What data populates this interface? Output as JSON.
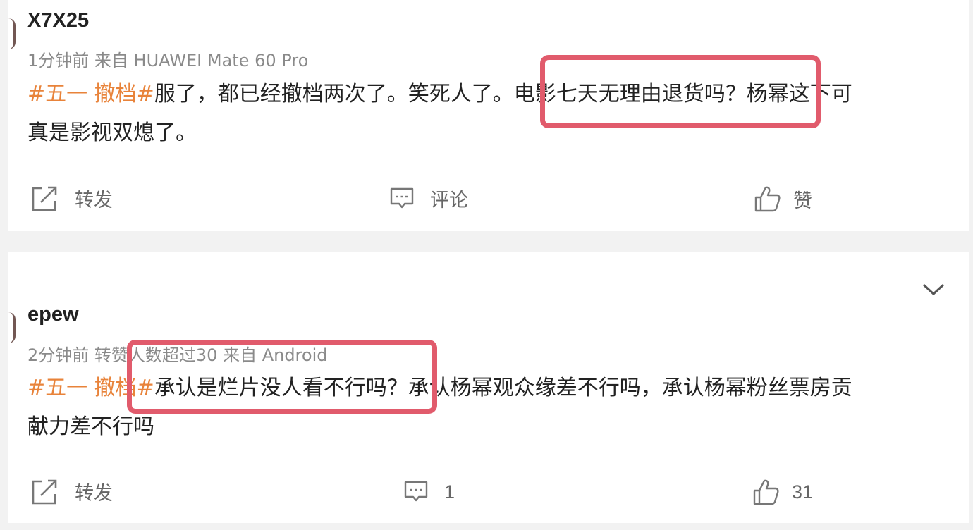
{
  "posts": [
    {
      "username": "X7X25",
      "meta": "1分钟前  来自 HUAWEI Mate 60 Pro",
      "topic": "#五一 撤档#",
      "text_line1": "服了，都已经撤档两次了。笑死人了。电影七天无理由退货吗？杨幂这下可",
      "text_line2": "真是影视双熄了。",
      "actions": {
        "repost_label": "转发",
        "comment_label": "评论",
        "like_label": "赞"
      }
    },
    {
      "username": "epew",
      "meta": "2分钟前  转赞人数超过30  来自 Android",
      "topic": "#五一 撤档#",
      "text_line1": "承认是烂片没人看不行吗？承认杨幂观众缘差不行吗，承认杨幂粉丝票房贡",
      "text_line2": "献力差不行吗",
      "actions": {
        "repost_label": "转发",
        "comment_count": "1",
        "like_count": "31"
      }
    }
  ],
  "icons": {
    "repost": "share-icon",
    "comment": "comment-icon",
    "like": "thumbs-up-icon",
    "expand": "chevron-down-icon"
  },
  "colors": {
    "topic": "#e8833a",
    "highlight_box": "#e15b6c",
    "background": "#f2f2f2",
    "card": "#ffffff"
  }
}
